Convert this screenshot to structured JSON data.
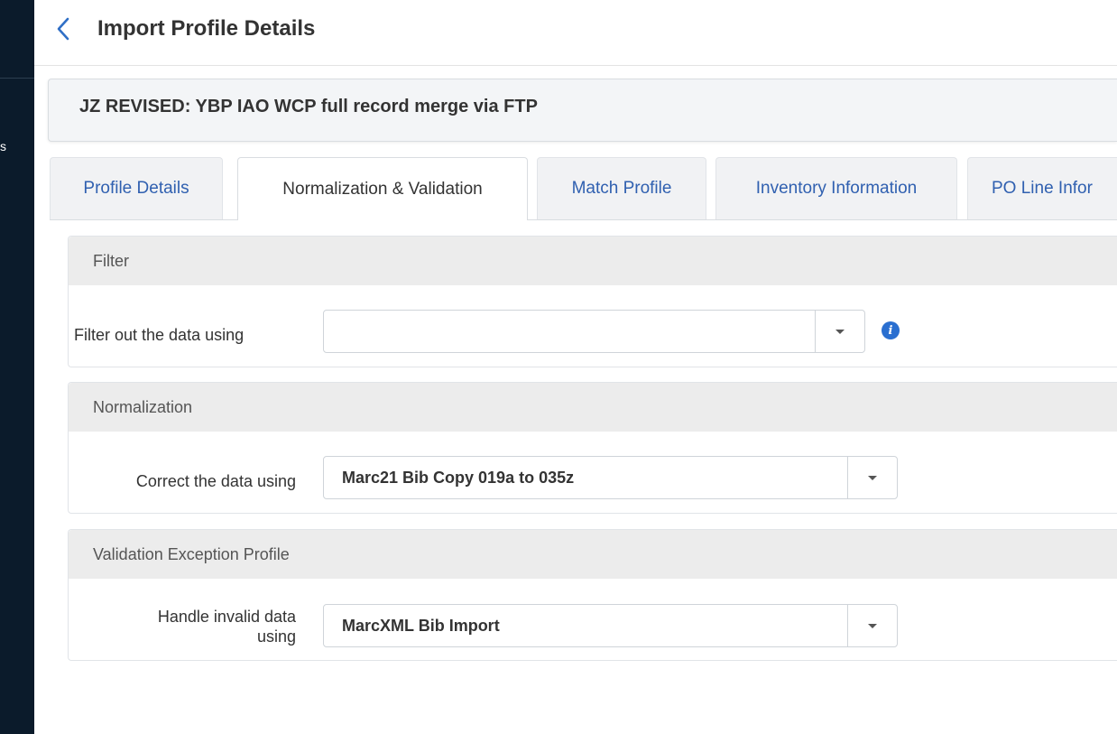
{
  "left_rail": {
    "fragment": "s"
  },
  "header": {
    "title": "Import Profile Details",
    "back_icon": "chevron-left-icon"
  },
  "profile": {
    "name": "JZ REVISED: YBP IAO WCP full record merge via FTP"
  },
  "tabs": [
    {
      "label": "Profile Details",
      "active": false
    },
    {
      "label": "Normalization & Validation",
      "active": true
    },
    {
      "label": "Match Profile",
      "active": false
    },
    {
      "label": "Inventory Information",
      "active": false
    },
    {
      "label": "PO Line Infor",
      "active": false
    }
  ],
  "sections": {
    "filter": {
      "title": "Filter",
      "field_label": "Filter out the data using",
      "value": "",
      "info_icon": "info-icon"
    },
    "normalization": {
      "title": "Normalization",
      "field_label": "Correct the data using",
      "value": "Marc21 Bib Copy 019a to 035z"
    },
    "validation": {
      "title": "Validation Exception Profile",
      "field_label_line1": "Handle invalid data",
      "field_label_line2": "using",
      "value": "MarcXML Bib Import"
    }
  },
  "colors": {
    "accent": "#3060b0",
    "rail": "#0b1b2b",
    "section_header_bg": "#ececec",
    "info_icon": "#2a6fd0"
  }
}
